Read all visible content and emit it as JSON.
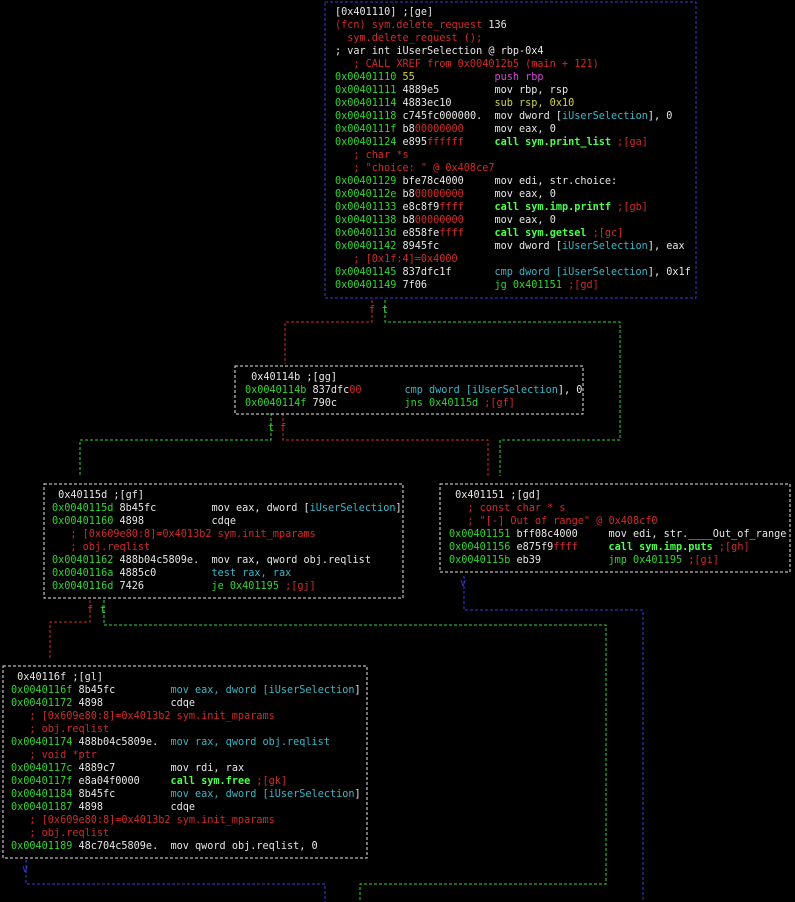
{
  "colors": {
    "background": "#000000",
    "white": "#e6e6e6",
    "green": "#2fd62f",
    "yellow": "#d6d63a",
    "red": "#d12a2a",
    "magenta": "#d545d5",
    "cyan": "#37b7c8",
    "bold_green": "#4dff4d",
    "blue_border": "#3a3ad6",
    "edge_green": "#2fd62f",
    "edge_red": "#d12a2a",
    "edge_blue": "#3a3ad6"
  },
  "nodes": [
    {
      "id": "ge",
      "border": "blue",
      "lines": [
        [
          {
            "t": "[0x401110] ;[ge]",
            "c": "white"
          }
        ],
        [
          {
            "t": "(fcn) sym.delete_request",
            "c": "red"
          },
          {
            "t": " 136",
            "c": "white"
          }
        ],
        [
          {
            "t": "  sym.delete_request ();",
            "c": "red"
          }
        ],
        [
          {
            "t": "; var int iUserSelection @ rbp-0x4",
            "c": "white"
          }
        ],
        [
          {
            "t": "   ; CALL XREF from 0x004012b5 (main + 121)",
            "c": "red"
          }
        ],
        [
          {
            "t": "0x00401110 ",
            "c": "green"
          },
          {
            "t": "55",
            "c": "yellow"
          },
          {
            "t": "             ",
            "c": "white"
          },
          {
            "t": "push rbp",
            "c": "magenta"
          }
        ],
        [
          {
            "t": "0x00401111 ",
            "c": "green"
          },
          {
            "t": "4889e5",
            "c": "white"
          },
          {
            "t": "         ",
            "c": "white"
          },
          {
            "t": "mov rbp, rsp",
            "c": "white"
          }
        ],
        [
          {
            "t": "0x00401114 ",
            "c": "green"
          },
          {
            "t": "4883ec10",
            "c": "white"
          },
          {
            "t": "       ",
            "c": "white"
          },
          {
            "t": "sub rsp, 0x10",
            "c": "yellow"
          }
        ],
        [
          {
            "t": "0x00401118 ",
            "c": "green"
          },
          {
            "t": "c745fc",
            "c": "white"
          },
          {
            "t": "000000.",
            "c": "white"
          },
          {
            "t": "  ",
            "c": "white"
          },
          {
            "t": "mov dword [",
            "c": "white"
          },
          {
            "t": "iUserSelection",
            "c": "cyan"
          },
          {
            "t": "], 0",
            "c": "white"
          }
        ],
        [
          {
            "t": "0x0040111f ",
            "c": "green"
          },
          {
            "t": "b8",
            "c": "white"
          },
          {
            "t": "00000000",
            "c": "red"
          },
          {
            "t": "     ",
            "c": "white"
          },
          {
            "t": "mov eax, 0",
            "c": "white"
          }
        ],
        [
          {
            "t": "0x00401124 ",
            "c": "green"
          },
          {
            "t": "e895",
            "c": "white"
          },
          {
            "t": "ffffff",
            "c": "red"
          },
          {
            "t": "     ",
            "c": "white"
          },
          {
            "t": "call sym.print_list",
            "c": "bold_green"
          },
          {
            "t": " ;[ga]",
            "c": "red"
          }
        ],
        [
          {
            "t": "   ; char *s",
            "c": "red"
          }
        ],
        [
          {
            "t": "   ; \"choice: \" @ 0x408ce7",
            "c": "red"
          }
        ],
        [
          {
            "t": "0x00401129 ",
            "c": "green"
          },
          {
            "t": "bfe78c4000",
            "c": "white"
          },
          {
            "t": "     ",
            "c": "white"
          },
          {
            "t": "mov edi, str.choice:",
            "c": "white"
          }
        ],
        [
          {
            "t": "0x0040112e ",
            "c": "green"
          },
          {
            "t": "b8",
            "c": "white"
          },
          {
            "t": "00000000",
            "c": "red"
          },
          {
            "t": "     ",
            "c": "white"
          },
          {
            "t": "mov eax, 0",
            "c": "white"
          }
        ],
        [
          {
            "t": "0x00401133 ",
            "c": "green"
          },
          {
            "t": "e8c8f9",
            "c": "white"
          },
          {
            "t": "ffff",
            "c": "red"
          },
          {
            "t": "     ",
            "c": "white"
          },
          {
            "t": "call sym.imp.printf",
            "c": "bold_green"
          },
          {
            "t": " ;[gb]",
            "c": "red"
          }
        ],
        [
          {
            "t": "0x00401138 ",
            "c": "green"
          },
          {
            "t": "b8",
            "c": "white"
          },
          {
            "t": "00000000",
            "c": "red"
          },
          {
            "t": "     ",
            "c": "white"
          },
          {
            "t": "mov eax, 0",
            "c": "white"
          }
        ],
        [
          {
            "t": "0x0040113d ",
            "c": "green"
          },
          {
            "t": "e858fe",
            "c": "white"
          },
          {
            "t": "ffff",
            "c": "red"
          },
          {
            "t": "     ",
            "c": "white"
          },
          {
            "t": "call sym.getsel",
            "c": "bold_green"
          },
          {
            "t": " ;[gc]",
            "c": "red"
          }
        ],
        [
          {
            "t": "0x00401142 ",
            "c": "green"
          },
          {
            "t": "8945fc",
            "c": "white"
          },
          {
            "t": "         ",
            "c": "white"
          },
          {
            "t": "mov dword [",
            "c": "white"
          },
          {
            "t": "iUserSelection",
            "c": "cyan"
          },
          {
            "t": "], eax",
            "c": "white"
          }
        ],
        [
          {
            "t": "   ; [0x1f:4]=0x4000",
            "c": "red"
          }
        ],
        [
          {
            "t": "0x00401145 ",
            "c": "green"
          },
          {
            "t": "837dfc1f",
            "c": "white"
          },
          {
            "t": "       ",
            "c": "white"
          },
          {
            "t": "cmp dword [",
            "c": "cyan"
          },
          {
            "t": "iUserSelection",
            "c": "cyan"
          },
          {
            "t": "], 0x1f",
            "c": "white"
          }
        ],
        [
          {
            "t": "0x00401149 ",
            "c": "green"
          },
          {
            "t": "7f06",
            "c": "white"
          },
          {
            "t": "           ",
            "c": "white"
          },
          {
            "t": "jg 0x401151",
            "c": "green"
          },
          {
            "t": " ;[gd]",
            "c": "red"
          }
        ]
      ]
    },
    {
      "id": "gg",
      "border": "white",
      "lines": [
        [
          {
            "t": " 0x40114b ;[gg]",
            "c": "white"
          }
        ],
        [
          {
            "t": "0x0040114b ",
            "c": "green"
          },
          {
            "t": "837dfc",
            "c": "white"
          },
          {
            "t": "00",
            "c": "red"
          },
          {
            "t": "       ",
            "c": "white"
          },
          {
            "t": "cmp dword [",
            "c": "cyan"
          },
          {
            "t": "iUserSelection",
            "c": "cyan"
          },
          {
            "t": "], 0",
            "c": "white"
          }
        ],
        [
          {
            "t": "0x0040114f ",
            "c": "green"
          },
          {
            "t": "790c",
            "c": "white"
          },
          {
            "t": "           ",
            "c": "white"
          },
          {
            "t": "jns 0x40115d",
            "c": "green"
          },
          {
            "t": " ;[gf]",
            "c": "red"
          }
        ]
      ]
    },
    {
      "id": "gf",
      "border": "white",
      "lines": [
        [
          {
            "t": " 0x40115d ;[gf]",
            "c": "white"
          }
        ],
        [
          {
            "t": "0x0040115d ",
            "c": "green"
          },
          {
            "t": "8b45fc",
            "c": "white"
          },
          {
            "t": "         ",
            "c": "white"
          },
          {
            "t": "mov eax, dword [",
            "c": "white"
          },
          {
            "t": "iUserSelection",
            "c": "cyan"
          },
          {
            "t": "]",
            "c": "white"
          }
        ],
        [
          {
            "t": "0x00401160 ",
            "c": "green"
          },
          {
            "t": "4898",
            "c": "white"
          },
          {
            "t": "           ",
            "c": "white"
          },
          {
            "t": "cdqe",
            "c": "white"
          }
        ],
        [
          {
            "t": "   ; [0x609e80:8]=0x4013b2 sym.init_mparams",
            "c": "red"
          }
        ],
        [
          {
            "t": "   ; obj.reqlist",
            "c": "red"
          }
        ],
        [
          {
            "t": "0x00401162 ",
            "c": "green"
          },
          {
            "t": "488b04c5809e.",
            "c": "white"
          },
          {
            "t": "  ",
            "c": "white"
          },
          {
            "t": "mov rax, qword obj.reqlist",
            "c": "white"
          }
        ],
        [
          {
            "t": "0x0040116a ",
            "c": "green"
          },
          {
            "t": "4885c0",
            "c": "white"
          },
          {
            "t": "         ",
            "c": "white"
          },
          {
            "t": "test rax, rax",
            "c": "cyan"
          }
        ],
        [
          {
            "t": "0x0040116d ",
            "c": "green"
          },
          {
            "t": "7426",
            "c": "white"
          },
          {
            "t": "           ",
            "c": "white"
          },
          {
            "t": "je 0x401195",
            "c": "green"
          },
          {
            "t": " ;[gj]",
            "c": "red"
          }
        ]
      ]
    },
    {
      "id": "gd",
      "border": "white",
      "lines": [
        [
          {
            "t": " 0x401151 ;[gd]",
            "c": "white"
          }
        ],
        [
          {
            "t": "   ; const char * s",
            "c": "red"
          }
        ],
        [
          {
            "t": "   ; \"[-] Out of range\" @ 0x408cf0",
            "c": "red"
          }
        ],
        [
          {
            "t": "0x00401151 ",
            "c": "green"
          },
          {
            "t": "bff08c4000",
            "c": "white"
          },
          {
            "t": "     ",
            "c": "white"
          },
          {
            "t": "mov edi, str.____Out_of_range",
            "c": "white"
          }
        ],
        [
          {
            "t": "0x00401156 ",
            "c": "green"
          },
          {
            "t": "e875f9",
            "c": "white"
          },
          {
            "t": "ffff",
            "c": "red"
          },
          {
            "t": "     ",
            "c": "white"
          },
          {
            "t": "call sym.imp.puts",
            "c": "bold_green"
          },
          {
            "t": " ;[gh]",
            "c": "red"
          }
        ],
        [
          {
            "t": "0x0040115b ",
            "c": "green"
          },
          {
            "t": "eb39",
            "c": "white"
          },
          {
            "t": "           ",
            "c": "white"
          },
          {
            "t": "jmp 0x401195",
            "c": "green"
          },
          {
            "t": " ;[gi]",
            "c": "red"
          }
        ]
      ]
    },
    {
      "id": "gl",
      "border": "white",
      "lines": [
        [
          {
            "t": " 0x40116f ;[gl]",
            "c": "white"
          }
        ],
        [
          {
            "t": "0x0040116f ",
            "c": "green"
          },
          {
            "t": "8b45fc",
            "c": "white"
          },
          {
            "t": "         ",
            "c": "white"
          },
          {
            "t": "mov eax, dword [",
            "c": "cyan"
          },
          {
            "t": "iUserSelection",
            "c": "cyan"
          },
          {
            "t": "]",
            "c": "white"
          }
        ],
        [
          {
            "t": "0x00401172 ",
            "c": "green"
          },
          {
            "t": "4898",
            "c": "white"
          },
          {
            "t": "           ",
            "c": "white"
          },
          {
            "t": "cdqe",
            "c": "white"
          }
        ],
        [
          {
            "t": "   ; [0x609e80:8]=0x4013b2 sym.init_mparams",
            "c": "red"
          }
        ],
        [
          {
            "t": "   ; obj.reqlist",
            "c": "red"
          }
        ],
        [
          {
            "t": "0x00401174 ",
            "c": "green"
          },
          {
            "t": "488b04c5809e.",
            "c": "white"
          },
          {
            "t": "  ",
            "c": "white"
          },
          {
            "t": "mov rax, qword obj.reqlist",
            "c": "cyan"
          }
        ],
        [
          {
            "t": "   ; void *ptr",
            "c": "red"
          }
        ],
        [
          {
            "t": "0x0040117c ",
            "c": "green"
          },
          {
            "t": "4889c7",
            "c": "white"
          },
          {
            "t": "         ",
            "c": "white"
          },
          {
            "t": "mov rdi, rax",
            "c": "white"
          }
        ],
        [
          {
            "t": "0x0040117f ",
            "c": "green"
          },
          {
            "t": "e8a04f0000",
            "c": "white"
          },
          {
            "t": "     ",
            "c": "white"
          },
          {
            "t": "call sym.free",
            "c": "bold_green"
          },
          {
            "t": " ;[gk]",
            "c": "red"
          }
        ],
        [
          {
            "t": "0x00401184 ",
            "c": "green"
          },
          {
            "t": "8b45fc",
            "c": "white"
          },
          {
            "t": "         ",
            "c": "white"
          },
          {
            "t": "mov eax, dword [",
            "c": "cyan"
          },
          {
            "t": "iUserSelection",
            "c": "cyan"
          },
          {
            "t": "]",
            "c": "white"
          }
        ],
        [
          {
            "t": "0x00401187 ",
            "c": "green"
          },
          {
            "t": "4898",
            "c": "white"
          },
          {
            "t": "           ",
            "c": "white"
          },
          {
            "t": "cdqe",
            "c": "white"
          }
        ],
        [
          {
            "t": "   ; [0x609e80:8]=0x4013b2 sym.init_mparams",
            "c": "red"
          }
        ],
        [
          {
            "t": "   ; obj.reqlist",
            "c": "red"
          }
        ],
        [
          {
            "t": "0x00401189 ",
            "c": "green"
          },
          {
            "t": "48c704c5809e.",
            "c": "white"
          },
          {
            "t": "  ",
            "c": "white"
          },
          {
            "t": "mov qword obj.reqlist, 0",
            "c": "white"
          }
        ]
      ]
    }
  ],
  "edge_labels": [
    {
      "id": "ge-t",
      "text": "t",
      "c": "green"
    },
    {
      "id": "ge-f",
      "text": "f",
      "c": "red"
    },
    {
      "id": "gg-t",
      "text": "t",
      "c": "green"
    },
    {
      "id": "gg-f",
      "text": "f",
      "c": "red"
    },
    {
      "id": "gf-f",
      "text": "f",
      "c": "red"
    },
    {
      "id": "gf-t",
      "text": "t",
      "c": "green"
    },
    {
      "id": "arrow-gd",
      "text": "v",
      "c": "blue_border"
    },
    {
      "id": "arrow-bottom-left",
      "text": "v",
      "c": "blue_border"
    }
  ]
}
